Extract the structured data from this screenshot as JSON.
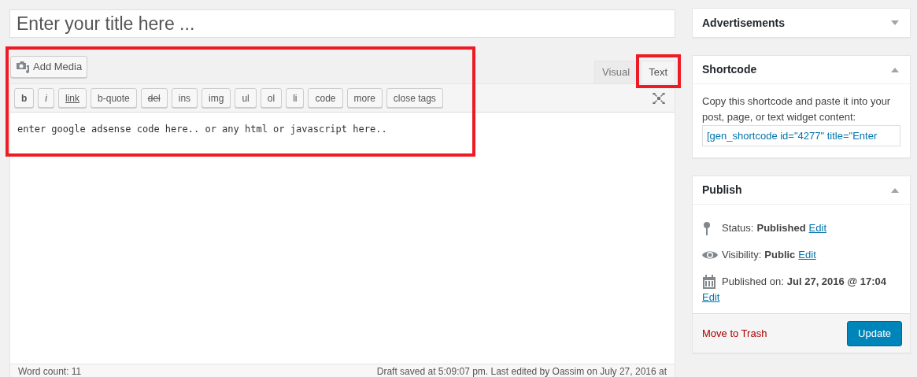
{
  "title_field": {
    "placeholder": "Enter your title here ..."
  },
  "editor": {
    "add_media": "Add Media",
    "tabs": [
      {
        "label": "Visual",
        "selected": false
      },
      {
        "label": "Text",
        "selected": true
      }
    ],
    "quicktags": [
      {
        "label": "b",
        "kind": "bold"
      },
      {
        "label": "i",
        "kind": "italic"
      },
      {
        "label": "link",
        "kind": "underline"
      },
      {
        "label": "b-quote",
        "kind": "plain"
      },
      {
        "label": "del",
        "kind": "strike"
      },
      {
        "label": "ins",
        "kind": "plain"
      },
      {
        "label": "img",
        "kind": "plain"
      },
      {
        "label": "ul",
        "kind": "plain"
      },
      {
        "label": "ol",
        "kind": "plain"
      },
      {
        "label": "li",
        "kind": "plain"
      },
      {
        "label": "code",
        "kind": "plain"
      },
      {
        "label": "more",
        "kind": "plain"
      },
      {
        "label": "close tags",
        "kind": "plain"
      }
    ],
    "content": "enter google adsense code here.. or any html or javascript here..",
    "word_count": "Word count: 11",
    "draft_status": "Draft saved at 5:09:07 pm. Last edited by Oassim on July 27, 2016 at"
  },
  "advertisements": {
    "title": "Advertisements",
    "expanded": false
  },
  "shortcode": {
    "title": "Shortcode",
    "expanded": true,
    "description": "Copy this shortcode and paste it into your post, page, or text widget content:",
    "value": "[gen_shortcode id=\"4277\" title=\"Enter"
  },
  "publish": {
    "title": "Publish",
    "expanded": true,
    "rows": [
      {
        "kind": "status",
        "label": "Status:",
        "value": "Published",
        "link": "Edit"
      },
      {
        "kind": "visibility",
        "label": "Visibility:",
        "value": "Public",
        "link": "Edit"
      },
      {
        "kind": "date",
        "label": "Published on:",
        "value": "Jul 27, 2016 @ 17:04",
        "link": "Edit"
      }
    ],
    "trash": "Move to Trash",
    "update": "Update"
  }
}
